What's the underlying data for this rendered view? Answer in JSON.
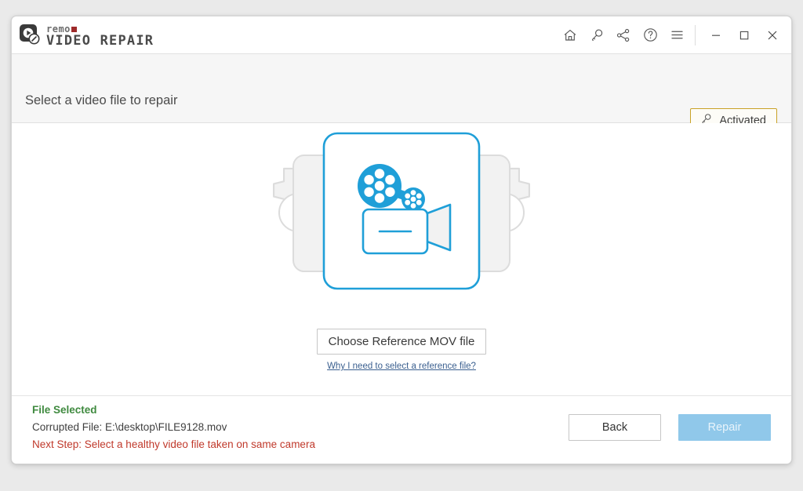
{
  "window": {
    "logo": {
      "brand_small": "remo",
      "brand_main": "VIDEO REPAIR"
    },
    "title_bar_icons": [
      {
        "name": "home-icon",
        "label": "Home"
      },
      {
        "name": "key-icon",
        "label": "Activate"
      },
      {
        "name": "share-icon",
        "label": "Share"
      },
      {
        "name": "help-icon",
        "label": "Help"
      },
      {
        "name": "menu-icon",
        "label": "Menu"
      }
    ],
    "controls": {
      "minimize": "Minimize",
      "maximize": "Maximize",
      "close": "Close"
    }
  },
  "header": {
    "page_title": "Select a video file to repair",
    "activated_label": "Activated"
  },
  "main": {
    "choose_file_label": "Choose Reference MOV file",
    "reference_help_link": "Why I need to select a reference file?",
    "illustration_name": "video-repair-illustration"
  },
  "footer": {
    "status_title": "File Selected",
    "corrupted_file": "Corrupted File: E:\\desktop\\FILE9128.mov",
    "next_step": "Next Step: Select a healthy video file taken on same camera",
    "back_label": "Back",
    "repair_label": "Repair"
  },
  "colors": {
    "accent_blue": "#1f9fd8",
    "activated_border": "#c9a227",
    "status_green": "#3f8a3f",
    "warning_red": "#c0392b",
    "repair_disabled": "#90c8ea",
    "gear_gray": "#eeeeee"
  }
}
